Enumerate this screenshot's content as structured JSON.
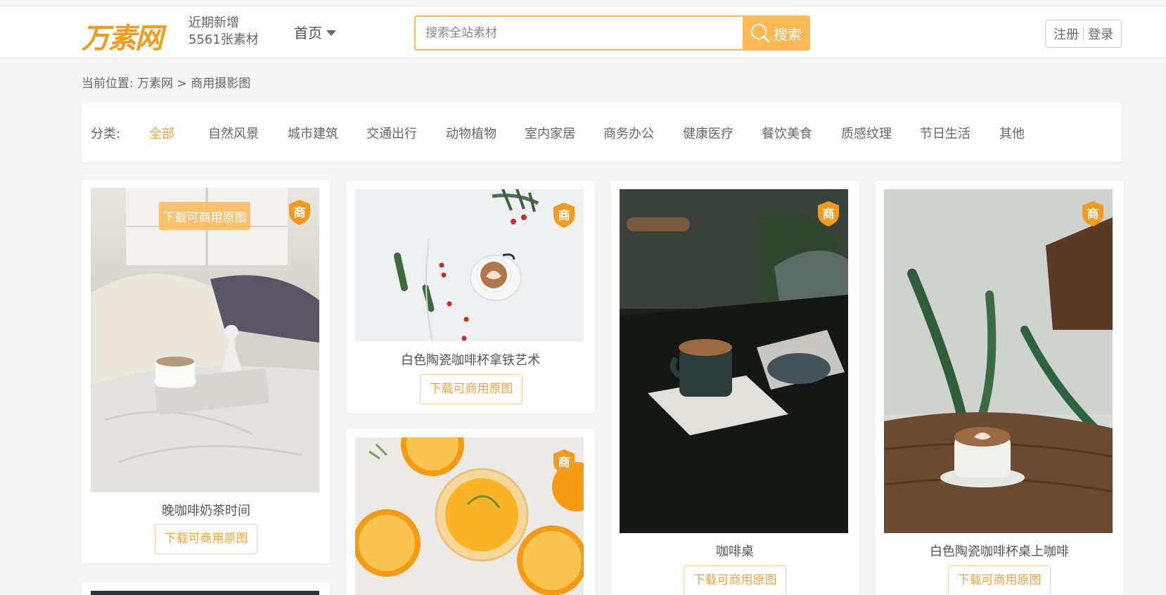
{
  "header": {
    "logo": "万素网",
    "tagline_line1": "近期新增",
    "tagline_line2": "5561张素材",
    "nav_home": "首页",
    "search_placeholder": "搜索全站素材",
    "search_button": "搜索",
    "register": "注册",
    "login": "登录"
  },
  "breadcrumb": {
    "prefix": "当前位置:",
    "site": "万素网",
    "sep": ">",
    "current": "商用摄影图"
  },
  "categories": {
    "label": "分类:",
    "items": [
      "全部",
      "自然风景",
      "城市建筑",
      "交通出行",
      "动物植物",
      "室内家居",
      "商务办公",
      "健康医疗",
      "餐饮美食",
      "质感纹理",
      "节日生活",
      "其他"
    ],
    "active": "全部"
  },
  "badge_text": "商",
  "cards": [
    {
      "title": "晚咖啡奶茶时间",
      "download": "下载可商用原图",
      "hover_download": "下载可商用原图"
    },
    {
      "title": "白色陶瓷咖啡杯拿铁艺术",
      "download": "下载可商用原图"
    },
    {
      "title": "咖啡桌",
      "download": "下载可商用原图"
    },
    {
      "title": "白色陶瓷咖啡杯桌上咖啡",
      "download": "下载可商用原图"
    },
    {
      "title": "",
      "download": ""
    }
  ],
  "colors": {
    "accent": "#f7a23b",
    "search_button": "#fbb855",
    "badge": "#f39b1f"
  }
}
